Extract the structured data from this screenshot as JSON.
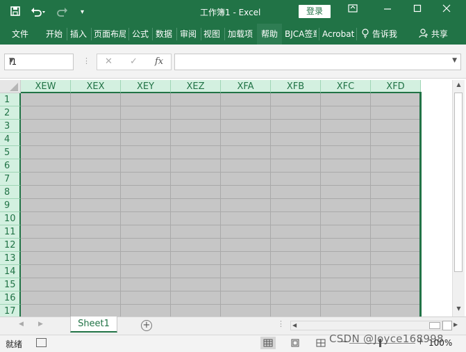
{
  "titlebar": {
    "title": "工作簿1  -   Excel",
    "login": "登录",
    "icons": [
      "save-icon",
      "undo-icon",
      "redo-icon",
      "customize-icon",
      "ribbon-options-icon",
      "minimize-icon",
      "maximize-icon",
      "close-icon"
    ]
  },
  "ribbon": {
    "tabs": [
      "文件",
      "开始",
      "插入",
      "页面布局",
      "公式",
      "数据",
      "审阅",
      "视图",
      "加载项",
      "帮助",
      "BJCA签章",
      "Acrobat"
    ],
    "active": "帮助",
    "tell": "告诉我",
    "share": "共享"
  },
  "formula_bar": {
    "name_box": "I1",
    "formula": ""
  },
  "grid": {
    "columns": [
      "XEW",
      "XEX",
      "XEY",
      "XEZ",
      "XFA",
      "XFB",
      "XFC",
      "XFD"
    ],
    "rows": [
      "1",
      "2",
      "3",
      "4",
      "5",
      "6",
      "7",
      "8",
      "9",
      "10",
      "11",
      "12",
      "13",
      "14",
      "15",
      "16",
      "17"
    ],
    "fill_color": "#c6c6c6",
    "accent": "#217346"
  },
  "sheets": {
    "tabs": [
      "Sheet1"
    ],
    "active": "Sheet1"
  },
  "status": {
    "ready": "就绪",
    "zoom": "100%"
  },
  "watermark": "CSDN @Joyce168998"
}
